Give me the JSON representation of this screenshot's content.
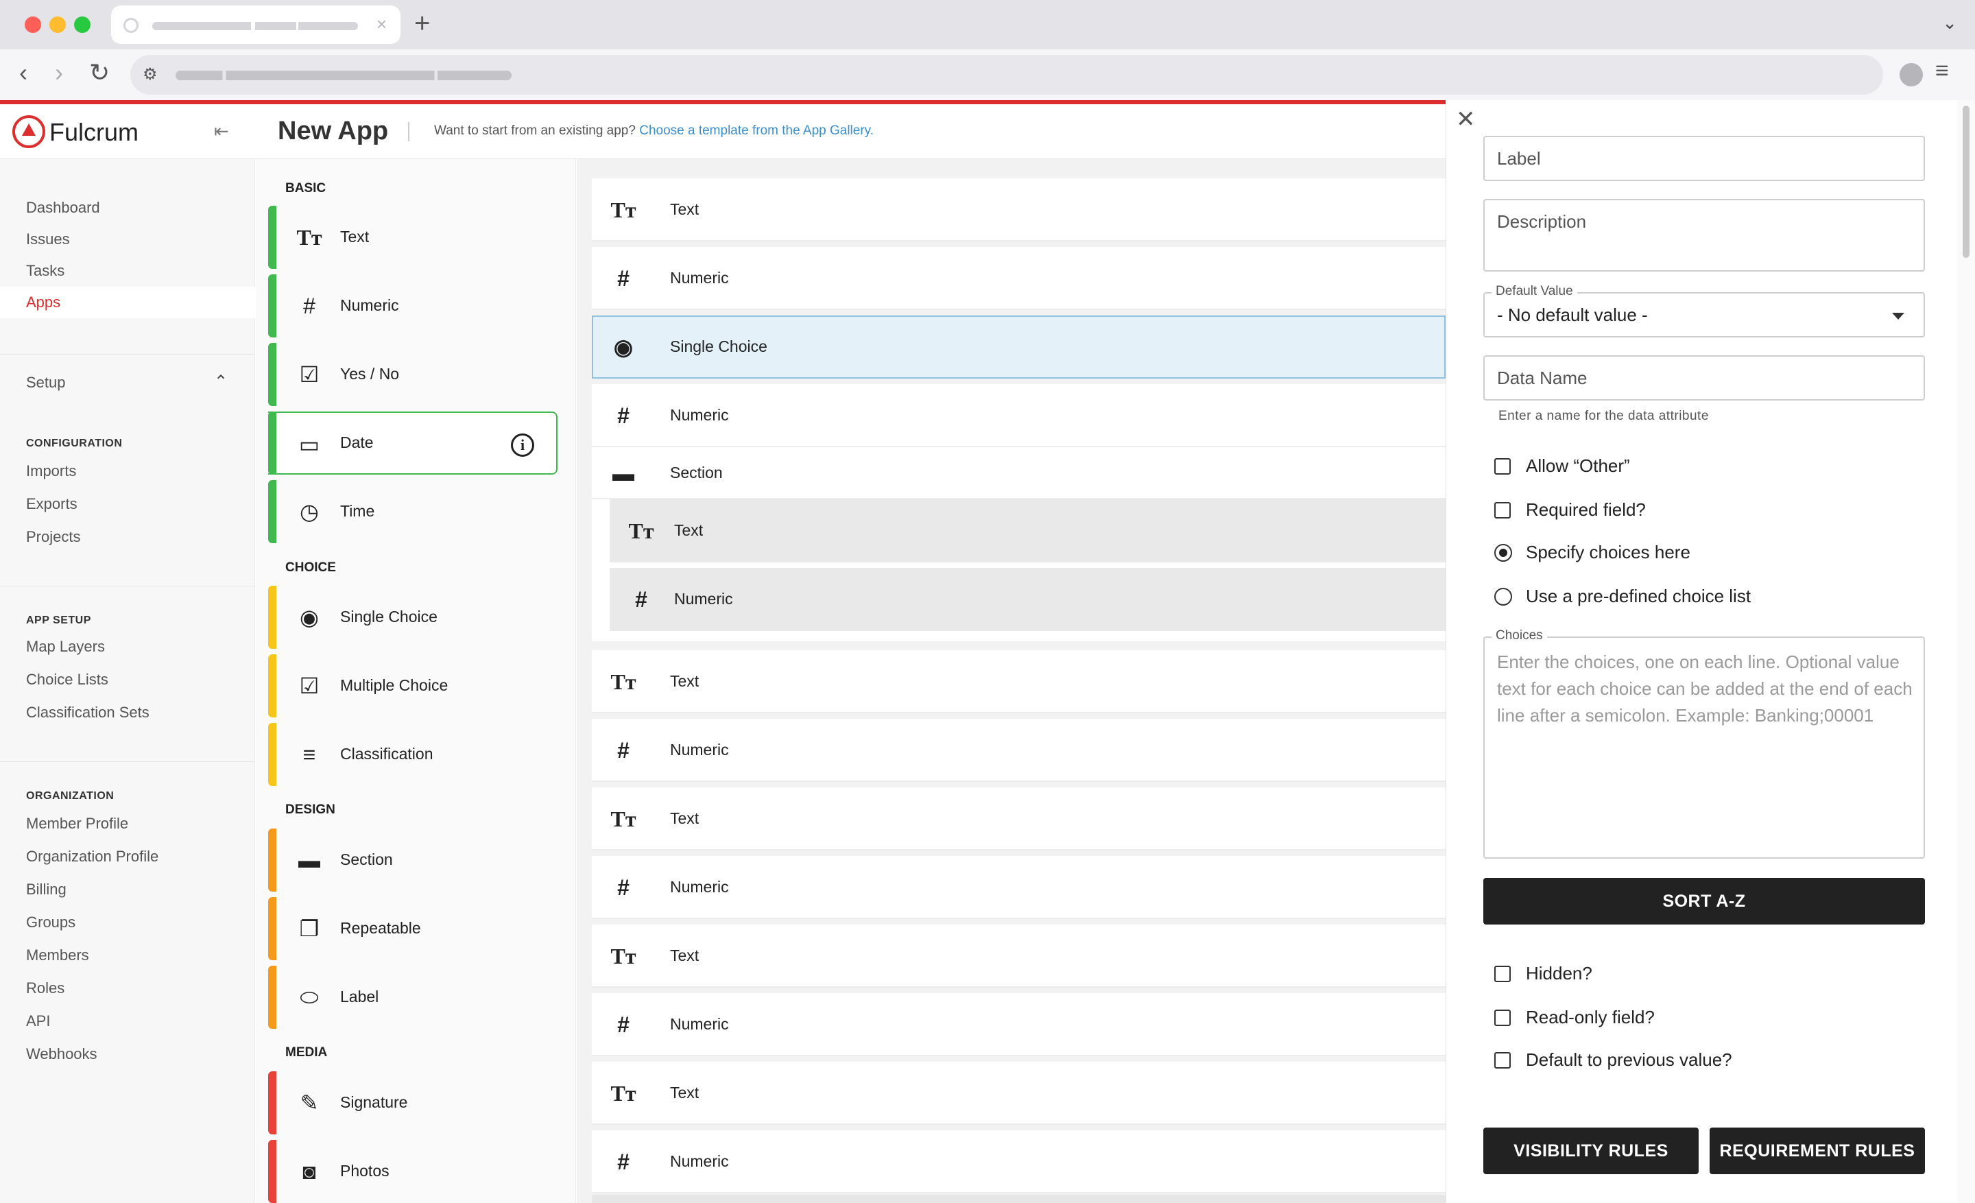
{
  "browser": {
    "new_tab_label": "+",
    "tab_close": "×",
    "tab_menu": "⌄",
    "nav": {
      "back": "‹",
      "forward": "›",
      "reload": "↻"
    }
  },
  "brand": {
    "name": "Fulcrum"
  },
  "sidebar": {
    "items": [
      {
        "label": "Dashboard"
      },
      {
        "label": "Issues"
      },
      {
        "label": "Tasks"
      },
      {
        "label": "Apps"
      }
    ],
    "setup_label": "Setup",
    "configuration": {
      "heading": "CONFIGURATION",
      "items": [
        "Imports",
        "Exports",
        "Projects"
      ]
    },
    "app_setup": {
      "heading": "APP SETUP",
      "items": [
        "Map Layers",
        "Choice Lists",
        "Classification Sets"
      ]
    },
    "organization": {
      "heading": "ORGANIZATION",
      "items": [
        "Member Profile",
        "Organization Profile",
        "Billing",
        "Groups",
        "Members",
        "Roles",
        "API",
        "Webhooks"
      ]
    }
  },
  "header": {
    "title": "New App",
    "hint": "Want to start from an existing app?",
    "link": "Choose a template from the App Gallery."
  },
  "palette": {
    "basic": {
      "heading": "BASIC",
      "items": [
        "Text",
        "Numeric",
        "Yes / No",
        "Date",
        "Time"
      ]
    },
    "choice": {
      "heading": "CHOICE",
      "items": [
        "Single Choice",
        "Multiple Choice",
        "Classification"
      ]
    },
    "design": {
      "heading": "DESIGN",
      "items": [
        "Section",
        "Repeatable",
        "Label"
      ]
    },
    "media": {
      "heading": "MEDIA",
      "items": [
        "Signature",
        "Photos"
      ]
    },
    "colors": {
      "basic": "#3fb950",
      "choice": "#f5c518",
      "design": "#f59a1b",
      "media": "#e8423a"
    }
  },
  "canvas": {
    "fields": [
      {
        "label": "Text",
        "icon": "text-icon"
      },
      {
        "label": "Numeric",
        "icon": "hash-icon"
      },
      {
        "label": "Single Choice",
        "icon": "radio-icon"
      },
      {
        "label": "Numeric",
        "icon": "hash-icon"
      },
      {
        "label": "Section",
        "icon": "folder-icon"
      },
      {
        "label": "Text",
        "icon": "text-icon"
      },
      {
        "label": "Numeric",
        "icon": "hash-icon"
      },
      {
        "label": "Text",
        "icon": "text-icon"
      },
      {
        "label": "Numeric",
        "icon": "hash-icon"
      },
      {
        "label": "Text",
        "icon": "text-icon"
      },
      {
        "label": "Numeric",
        "icon": "hash-icon"
      },
      {
        "label": "Text",
        "icon": "text-icon"
      },
      {
        "label": "Numeric",
        "icon": "hash-icon"
      },
      {
        "label": "Text",
        "icon": "text-icon"
      },
      {
        "label": "Numeric",
        "icon": "hash-icon"
      }
    ]
  },
  "panel": {
    "label_placeholder": "Label",
    "description_placeholder": "Description",
    "default_value": {
      "label": "Default Value",
      "value": "- No default value -"
    },
    "data_name": {
      "placeholder": "Data Name",
      "helper": "Enter a name for the data attribute"
    },
    "options": {
      "allow_other": "Allow “Other”",
      "required": "Required field?",
      "specify_choices": "Specify choices here",
      "predefined_list": "Use a pre-defined choice list"
    },
    "choices": {
      "label": "Choices",
      "placeholder": "Enter the choices, one on each line. Optional value text for each choice can be added at the end of each line after a semicolon. Example: Banking;00001"
    },
    "sort_button": "SORT A-Z",
    "flags": {
      "hidden": "Hidden?",
      "read_only": "Read-only field?",
      "default_previous": "Default to previous value?"
    },
    "visibility_button": "VISIBILITY RULES",
    "requirement_button": "REQUIREMENT RULES"
  }
}
